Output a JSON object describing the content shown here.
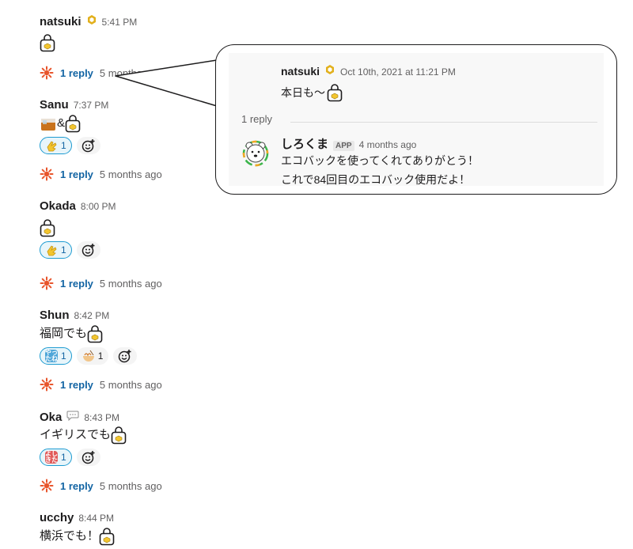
{
  "messages": [
    {
      "author": "natsuki",
      "time": "5:41 PM",
      "text": ""
    },
    {
      "author": "Sanu",
      "time": "7:37 PM",
      "text": "&"
    },
    {
      "author": "Okada",
      "time": "8:00 PM",
      "text": ""
    },
    {
      "author": "Shun",
      "time": "8:42 PM",
      "text": "福岡でも"
    },
    {
      "author": "Oka",
      "time": "8:43 PM",
      "text": "イギリスでも"
    },
    {
      "author": "ucchy",
      "time": "8:44 PM",
      "text": "横浜でも！"
    }
  ],
  "reactions": {
    "sanu_clap_count": "1",
    "okada_clap_count": "1",
    "shun_yatta_count": "1",
    "shun_ramen_count": "1",
    "oka_yoshi_count": "1"
  },
  "threads": {
    "reply_label": "1 reply",
    "reply_age": "5 months ago",
    "reply_age_truncated": "5 months ago"
  },
  "popover": {
    "orig_author": "natsuki",
    "orig_time": "Oct 10th, 2021 at 11:21 PM",
    "orig_text": "本日も〜",
    "reply_count": "1 reply",
    "bot_name": "しろくま",
    "bot_badge": "APP",
    "bot_time": "4 months ago",
    "bot_line1": "エコバックを使ってくれてありがとう！",
    "bot_line2": "これで84回目のエコバック使用だよ！"
  },
  "colors": {
    "link": "#1264a3",
    "reaction_border": "#1d9bd1",
    "reaction_bg": "#e8f5fa",
    "gold_badge": "#e2b01c",
    "thread_icon": "#e8552c"
  },
  "icons": [
    "eco-bag-icon",
    "gold-badge-icon",
    "thread-burst-icon",
    "add-reaction-icon",
    "clap-icon",
    "yatta-icon",
    "ramen-icon",
    "yoshi-icon",
    "whisky-icon",
    "speech-bubble-icon",
    "polar-bear-avatar"
  ]
}
